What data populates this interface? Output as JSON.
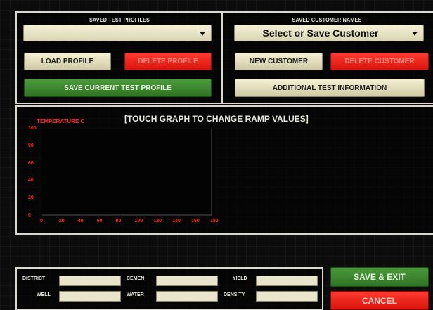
{
  "profiles": {
    "label": "SAVED TEST PROFILES",
    "selected": "",
    "load_button": "LOAD PROFILE",
    "delete_button": "DELETE PROFILE",
    "save_button": "SAVE CURRENT TEST PROFILE"
  },
  "customers": {
    "label": "SAVED CUSTOMER NAMES",
    "selected": "Select or Save Customer",
    "new_button": "NEW CUSTOMER",
    "delete_button": "DELETE CUSTOMER",
    "info_button": "ADDITIONAL TEST INFORMATION"
  },
  "graph": {
    "ylabel": "TEMPERATURE C",
    "instruction": "[TOUCH GRAPH TO CHANGE RAMP VALUES]",
    "y_ticks": [
      "100",
      "80",
      "60",
      "40",
      "20",
      "0"
    ],
    "x_ticks": [
      "0",
      "20",
      "40",
      "60",
      "80",
      "100",
      "120",
      "140",
      "160",
      "180"
    ]
  },
  "fields": {
    "district": "DISTRICT",
    "well": "WELL",
    "cement": "CEMEN",
    "water": "WATER",
    "yield": "YIELD",
    "density": "DENSITY"
  },
  "actions": {
    "save_exit": "SAVE & EXIT",
    "cancel": "CANCEL"
  },
  "colors": {
    "accent_red": "#e41b10",
    "accent_green": "#3e8c31",
    "beige": "#ebe7c8",
    "tick_red": "#ff2a1a"
  }
}
